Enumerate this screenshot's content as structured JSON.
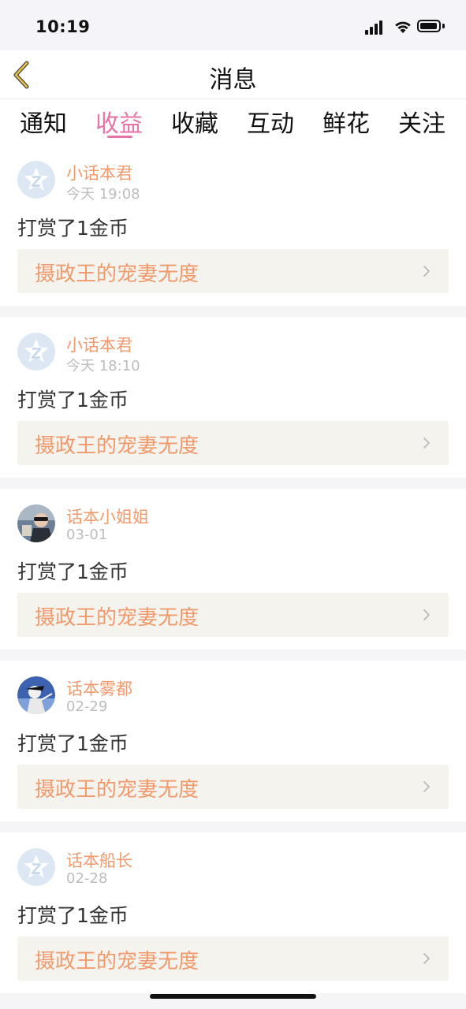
{
  "status_bar": {
    "time": "10:19"
  },
  "nav": {
    "title": "消息"
  },
  "tabs": [
    {
      "label": "通知"
    },
    {
      "label": "收益"
    },
    {
      "label": "收藏"
    },
    {
      "label": "互动"
    },
    {
      "label": "鲜花"
    },
    {
      "label": "关注"
    }
  ],
  "active_tab": "收益",
  "items": [
    {
      "username": "小话本君",
      "time": "今天 19:08",
      "action": "打赏了1金币",
      "book": "摄政王的宠妻无度",
      "avatar": "default-avatar"
    },
    {
      "username": "小话本君",
      "time": "今天 18:10",
      "action": "打赏了1金币",
      "book": "摄政王的宠妻无度",
      "avatar": "default-avatar"
    },
    {
      "username": "话本小姐姐",
      "time": "03-01",
      "action": "打赏了1金币",
      "book": "摄政王的宠妻无度",
      "avatar": "photo-avatar"
    },
    {
      "username": "话本雾都",
      "time": "02-29",
      "action": "打赏了1金币",
      "book": "摄政王的宠妻无度",
      "avatar": "photo-avatar"
    },
    {
      "username": "话本船长",
      "time": "02-28",
      "action": "打赏了1金币",
      "book": "摄政王的宠妻无度",
      "avatar": "default-avatar"
    }
  ],
  "colors": {
    "accent_pink": "#e473a7",
    "accent_orange": "#f09a6d",
    "link_bg": "#f4f3ed"
  }
}
